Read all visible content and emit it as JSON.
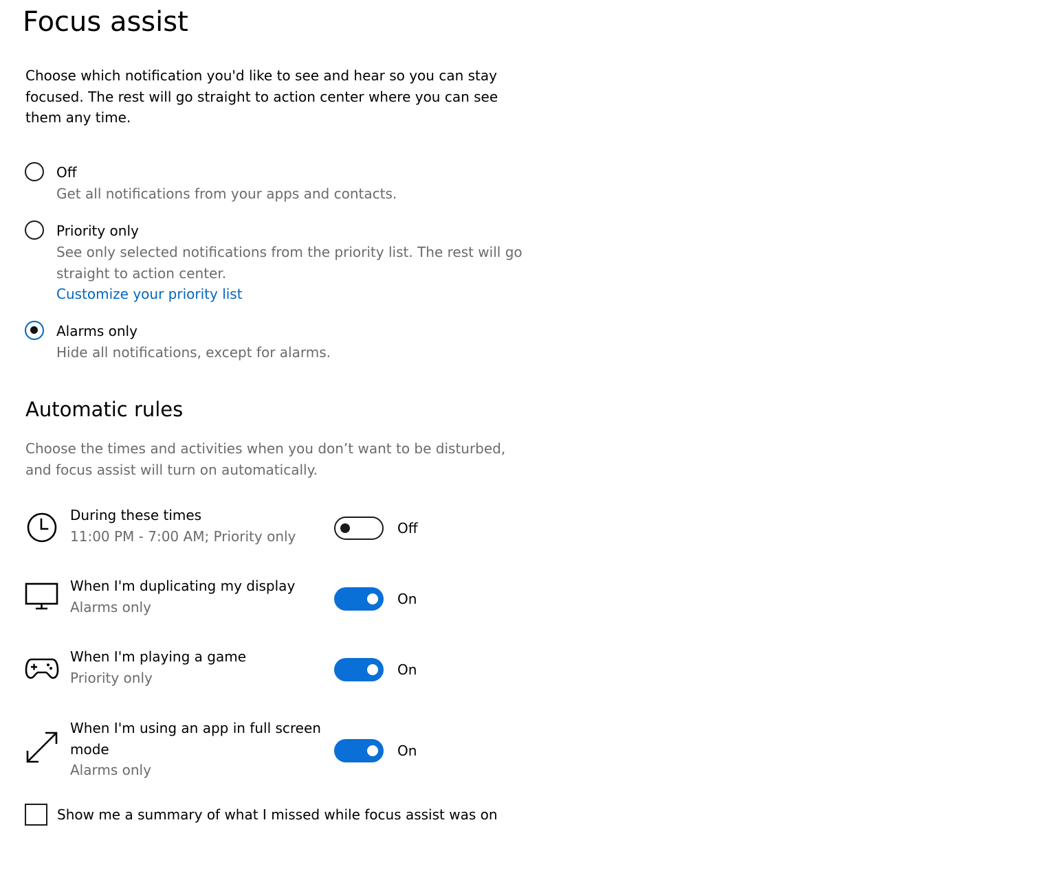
{
  "page": {
    "title": "Focus assist",
    "intro": "Choose which notification you'd like to see and hear so you can stay focused. The rest will go straight to action center where you can see them any time."
  },
  "modes": [
    {
      "label": "Off",
      "description": "Get all notifications from your apps and contacts.",
      "selected": false
    },
    {
      "label": "Priority only",
      "description": "See only selected notifications from the priority list. The rest will go straight to action center.",
      "link": "Customize your priority list",
      "selected": false
    },
    {
      "label": "Alarms only",
      "description": "Hide all notifications, except for alarms.",
      "selected": true
    }
  ],
  "automatic_rules": {
    "title": "Automatic rules",
    "description": "Choose the times and activities when you don’t want to be disturbed, and focus assist will turn on automatically.",
    "rules": [
      {
        "icon": "clock-icon",
        "title": "During these times",
        "subtitle": "11:00 PM - 7:00 AM; Priority only",
        "state": "Off",
        "enabled": false
      },
      {
        "icon": "monitor-icon",
        "title": "When I'm duplicating my display",
        "subtitle": "Alarms only",
        "state": "On",
        "enabled": true
      },
      {
        "icon": "gamepad-icon",
        "title": "When I'm playing a game",
        "subtitle": "Priority only",
        "state": "On",
        "enabled": true
      },
      {
        "icon": "fullscreen-icon",
        "title": "When I'm using an app in full screen mode",
        "subtitle": "Alarms only",
        "state": "On",
        "enabled": true
      }
    ]
  },
  "summary_checkbox": {
    "label": "Show me a summary of what I missed while focus assist was on",
    "checked": false
  },
  "colors": {
    "accent": "#0067c0",
    "toggle_on": "#0a6fd6",
    "secondary_text": "#6b6b6b"
  }
}
